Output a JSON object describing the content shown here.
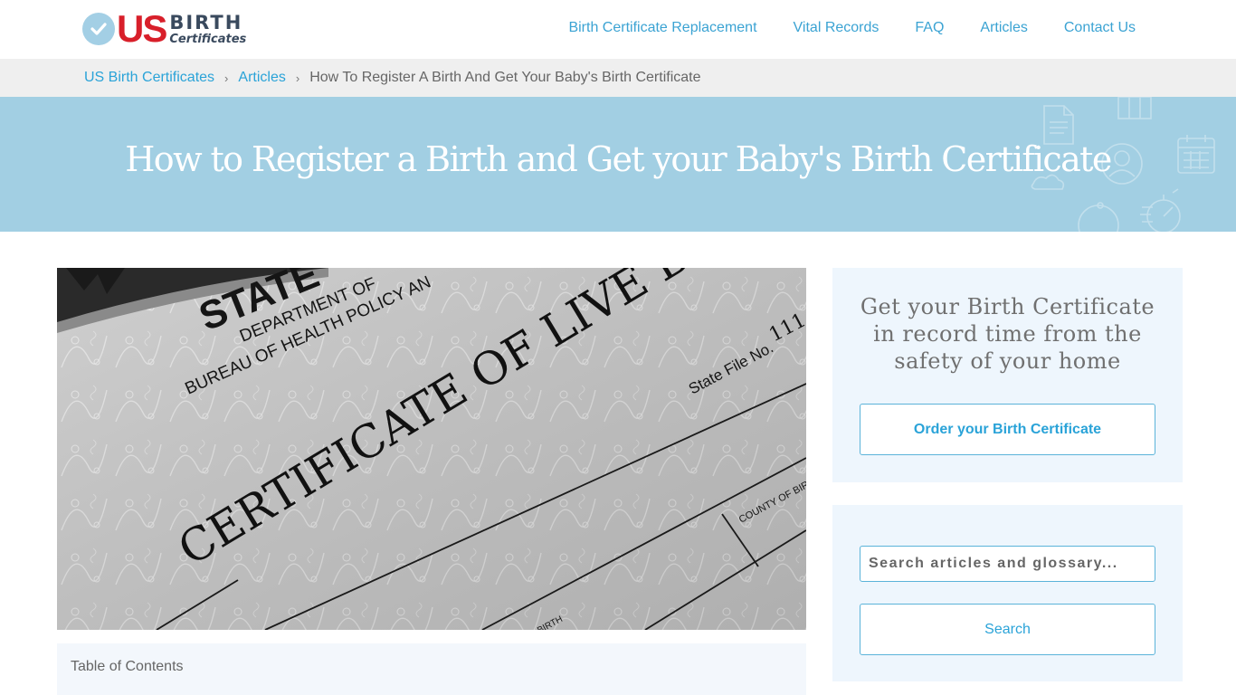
{
  "header": {
    "logo": {
      "us": "US",
      "birth": "BIRTH",
      "certificates": "Certificates"
    },
    "nav": [
      {
        "label": "Birth Certificate Replacement"
      },
      {
        "label": "Vital Records"
      },
      {
        "label": "FAQ"
      },
      {
        "label": "Articles"
      },
      {
        "label": "Contact Us"
      }
    ]
  },
  "breadcrumb": {
    "items": [
      {
        "label": "US Birth Certificates"
      },
      {
        "label": "Articles"
      }
    ],
    "separator": "›",
    "current": "How To Register A Birth And Get Your Baby's Birth Certificate"
  },
  "hero": {
    "title": "How to Register a Birth and Get your Baby's Birth Certificate"
  },
  "article": {
    "image": {
      "alt": "Certificate of Live Birth",
      "texts": {
        "state": "STATE",
        "department": "DEPARTMENT OF",
        "bureau": "BUREAU OF HEALTH POLICY AN",
        "certificate": "CERTIFICATE OF LIVE BIRTH",
        "file_no": "State File No.",
        "file_num": "111",
        "county": "COUNTY OF BIR",
        "birth": "BIRTH"
      }
    },
    "toc_label": "Table of Contents"
  },
  "sidebar": {
    "promo": {
      "heading": "Get your Birth Certificate in record time from the safety of your home",
      "button": "Order your Birth Certificate"
    },
    "search": {
      "placeholder": "Search articles and glossary...",
      "value": "",
      "button": "Search"
    }
  },
  "colors": {
    "accent": "#2aa3d8",
    "brand_red": "#d81f2a",
    "hero_bg": "#a2cfe3",
    "panel_bg": "#eef6fd"
  }
}
